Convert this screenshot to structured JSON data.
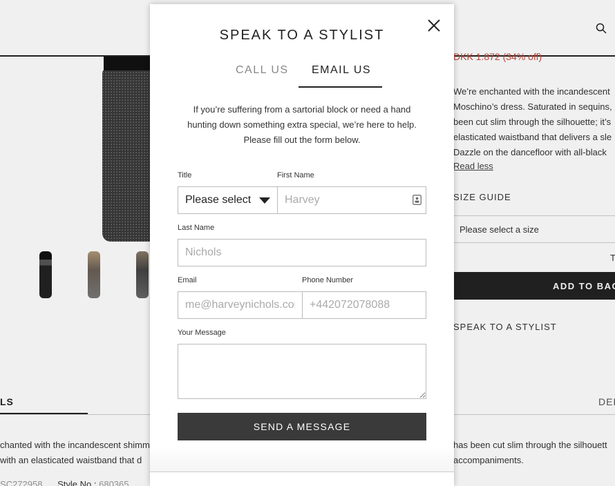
{
  "background": {
    "price": "DKK 1.872 (34% off)",
    "description_lines": [
      "We’re enchanted with the incandescent",
      "Moschino’s dress. Saturated in sequins,",
      "been cut slim through the silhouette; it’s",
      "elasticated waistband that delivers a sle",
      "Dazzle on the dancefloor with all-black"
    ],
    "read_less": "Read less",
    "size_guide": "SIZE GUIDE",
    "size_select": "Please select a size",
    "t_mark": "T",
    "add_to_bag": "ADD TO BAG",
    "speak_to_stylist": "SPEAK TO A STYLIST",
    "tab_details": "LS",
    "tab_right": "DEL",
    "body_left_1": "chanted with the incandescent shimm",
    "body_left_2": "with an elasticated waistband that d",
    "body_right_1": "has been cut slim through the silhouett",
    "body_right_2": "accompaniments.",
    "code_label": "SC272958",
    "style_label": "Style No :",
    "style_value": "680365"
  },
  "modal": {
    "title": "SPEAK TO A STYLIST",
    "tabs": [
      {
        "label": "CALL US",
        "active": false
      },
      {
        "label": "EMAIL US",
        "active": true
      }
    ],
    "intro_lines": [
      "If you’re suffering from a sartorial block or need a hand",
      "hunting down something extra special, we’re here to help.",
      "Please fill out the form below."
    ],
    "fields": {
      "title_label": "Title",
      "title_value": "Please select",
      "first_name_label": "First Name",
      "first_name_placeholder": "Harvey",
      "last_name_label": "Last Name",
      "last_name_placeholder": "Nichols",
      "email_label": "Email",
      "email_placeholder": "me@harveynichols.com",
      "phone_label": "Phone Number",
      "phone_placeholder": "+442072078088",
      "message_label": "Your Message",
      "message_value": ""
    },
    "send_label": "SEND A MESSAGE"
  },
  "icons": {
    "search": "search-icon",
    "close": "close-icon",
    "caret": "chevron-down-icon",
    "autofill": "contact-card-icon"
  }
}
